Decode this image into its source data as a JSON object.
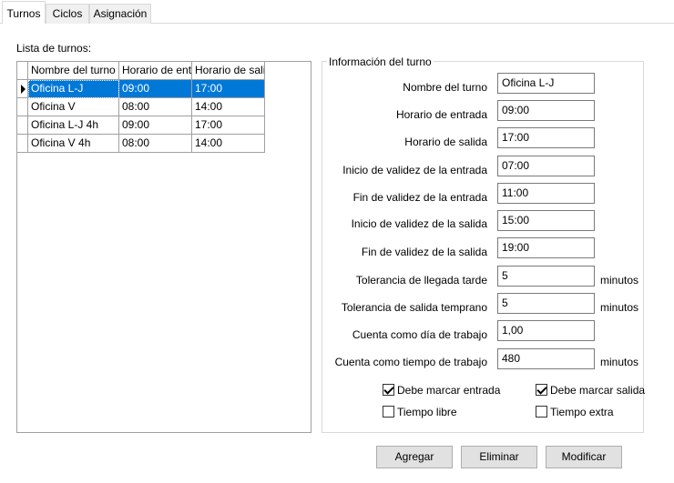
{
  "tabs": [
    "Turnos",
    "Ciclos",
    "Asignación"
  ],
  "list": {
    "label": "Lista de turnos:",
    "columns": [
      "Nombre del turno",
      "Horario de entrada",
      "Horario de salida"
    ],
    "rows": [
      [
        "Oficina L-J",
        "09:00",
        "17:00"
      ],
      [
        "Oficina V",
        "08:00",
        "14:00"
      ],
      [
        "Oficina L-J 4h",
        "09:00",
        "17:00"
      ],
      [
        "Oficina V 4h",
        "08:00",
        "14:00"
      ]
    ],
    "selected_row": 0
  },
  "info": {
    "title": "Información del turno",
    "fields": [
      {
        "label": "Nombre del turno",
        "value": "Oficina L-J",
        "unit": ""
      },
      {
        "label": "Horario de entrada",
        "value": "09:00",
        "unit": ""
      },
      {
        "label": "Horario de salida",
        "value": "17:00",
        "unit": ""
      },
      {
        "label": "Inicio de validez de la entrada",
        "value": "07:00",
        "unit": ""
      },
      {
        "label": "Fin de validez de la entrada",
        "value": "11:00",
        "unit": ""
      },
      {
        "label": "Inicio de validez de la salida",
        "value": "15:00",
        "unit": ""
      },
      {
        "label": "Fin de validez de la salida",
        "value": "19:00",
        "unit": ""
      },
      {
        "label": "Tolerancia de llegada tarde",
        "value": "5",
        "unit": "minutos"
      },
      {
        "label": "Tolerancia de salida temprano",
        "value": "5",
        "unit": "minutos"
      },
      {
        "label": "Cuenta como día de trabajo",
        "value": "1,00",
        "unit": ""
      },
      {
        "label": "Cuenta como tiempo de trabajo",
        "value": "480",
        "unit": "minutos"
      }
    ],
    "checkboxes": [
      {
        "label": "Debe marcar entrada",
        "checked": true
      },
      {
        "label": "Debe marcar salida",
        "checked": true
      },
      {
        "label": "Tiempo libre",
        "checked": false
      },
      {
        "label": "Tiempo extra",
        "checked": false
      }
    ]
  },
  "buttons": {
    "add": "Agregar",
    "delete": "Eliminar",
    "modify": "Modificar"
  },
  "colors": {
    "selection": "#0078d7",
    "button_bg": "#e1e1e1"
  }
}
